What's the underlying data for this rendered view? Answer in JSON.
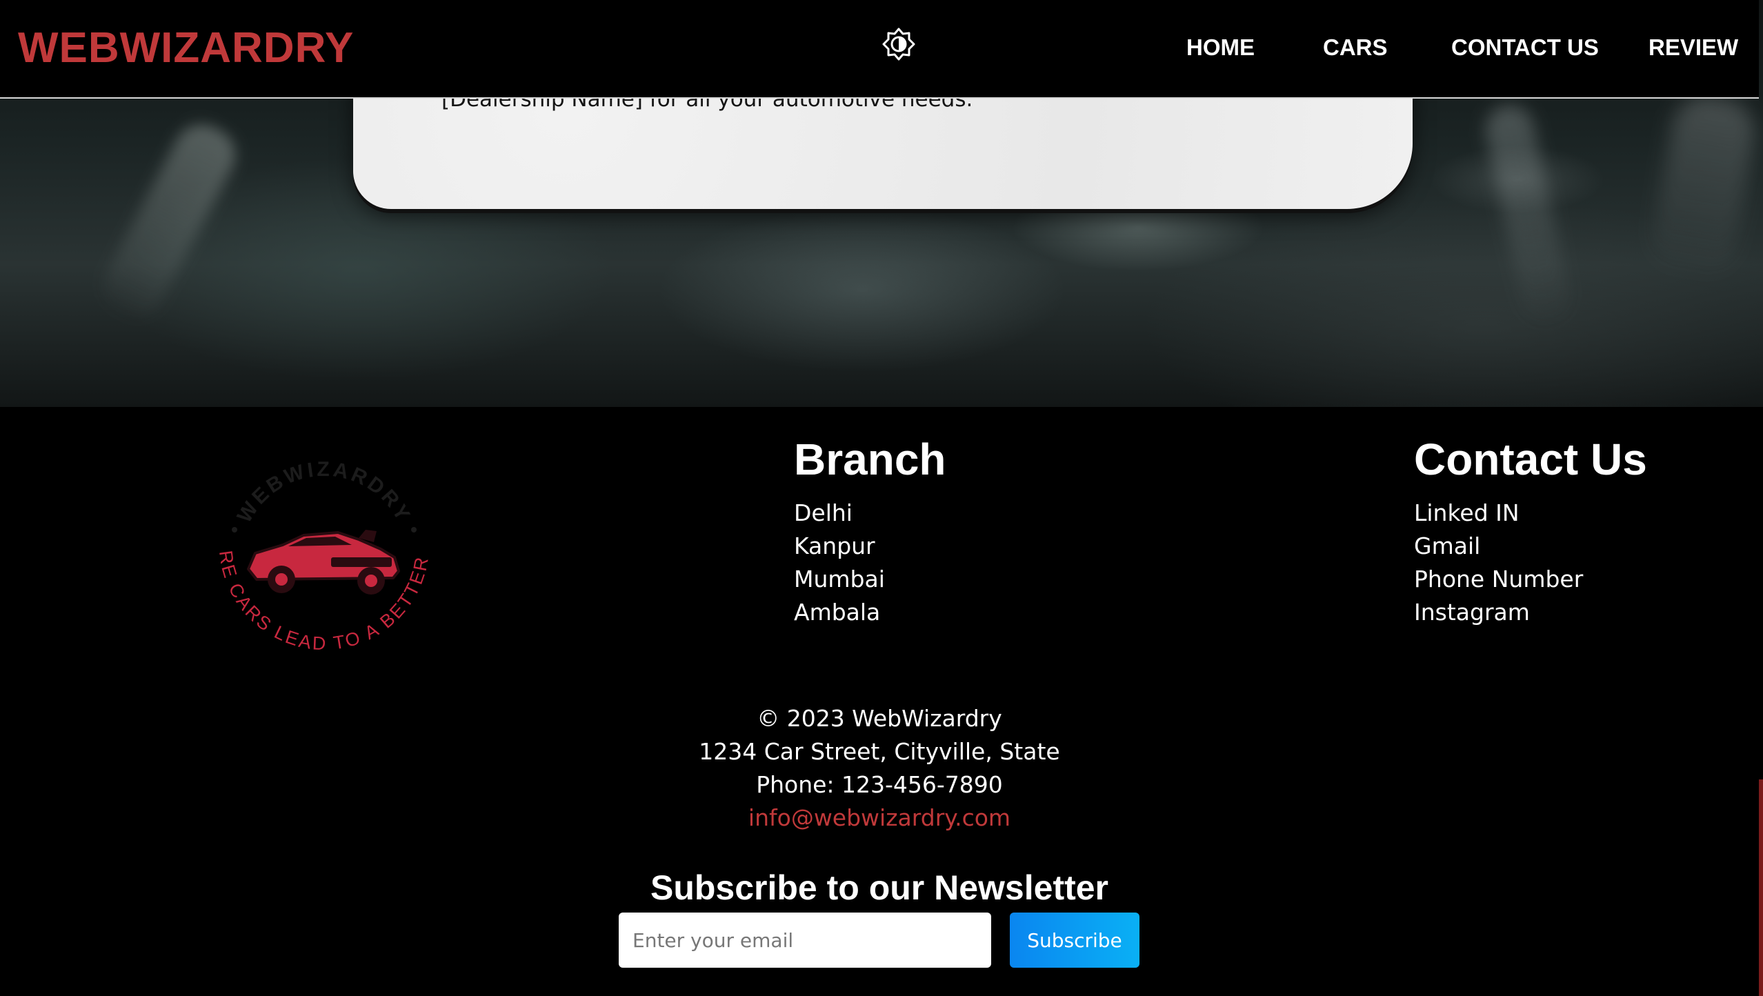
{
  "brand": {
    "name": "WEBWIZARDRY",
    "color": "#c0393a"
  },
  "header": {
    "theme_toggle_icon": "theme-toggle-icon",
    "nav": [
      {
        "label": "HOME"
      },
      {
        "label": "CARS"
      },
      {
        "label": "CONTACT US"
      },
      {
        "label": "REVIEW"
      }
    ]
  },
  "hero": {
    "card_text": "[Dealership Name] for all your automotive needs."
  },
  "footer": {
    "logo": {
      "arc_top": "WEBWIZARDRY",
      "arc_bottom": "WHERE CARS LEAD TO A BETTER LIFE",
      "accent_color": "#c8283f"
    },
    "branch": {
      "title": "Branch",
      "items": [
        "Delhi",
        "Kanpur",
        "Mumbai",
        "Ambala"
      ]
    },
    "contact": {
      "title": "Contact Us",
      "items": [
        "Linked IN",
        "Gmail",
        "Phone Number",
        "Instagram"
      ]
    },
    "info": {
      "copyright": "© 2023 WebWizardry",
      "address": "1234 Car Street, Cityville, State",
      "phone": "Phone: 123-456-7890",
      "email": "info@webwizardry.com"
    },
    "newsletter": {
      "title": "Subscribe to our Newsletter",
      "placeholder": "Enter your email",
      "value": "",
      "button_label": "Subscribe",
      "button_color": "#0a95f2"
    }
  }
}
